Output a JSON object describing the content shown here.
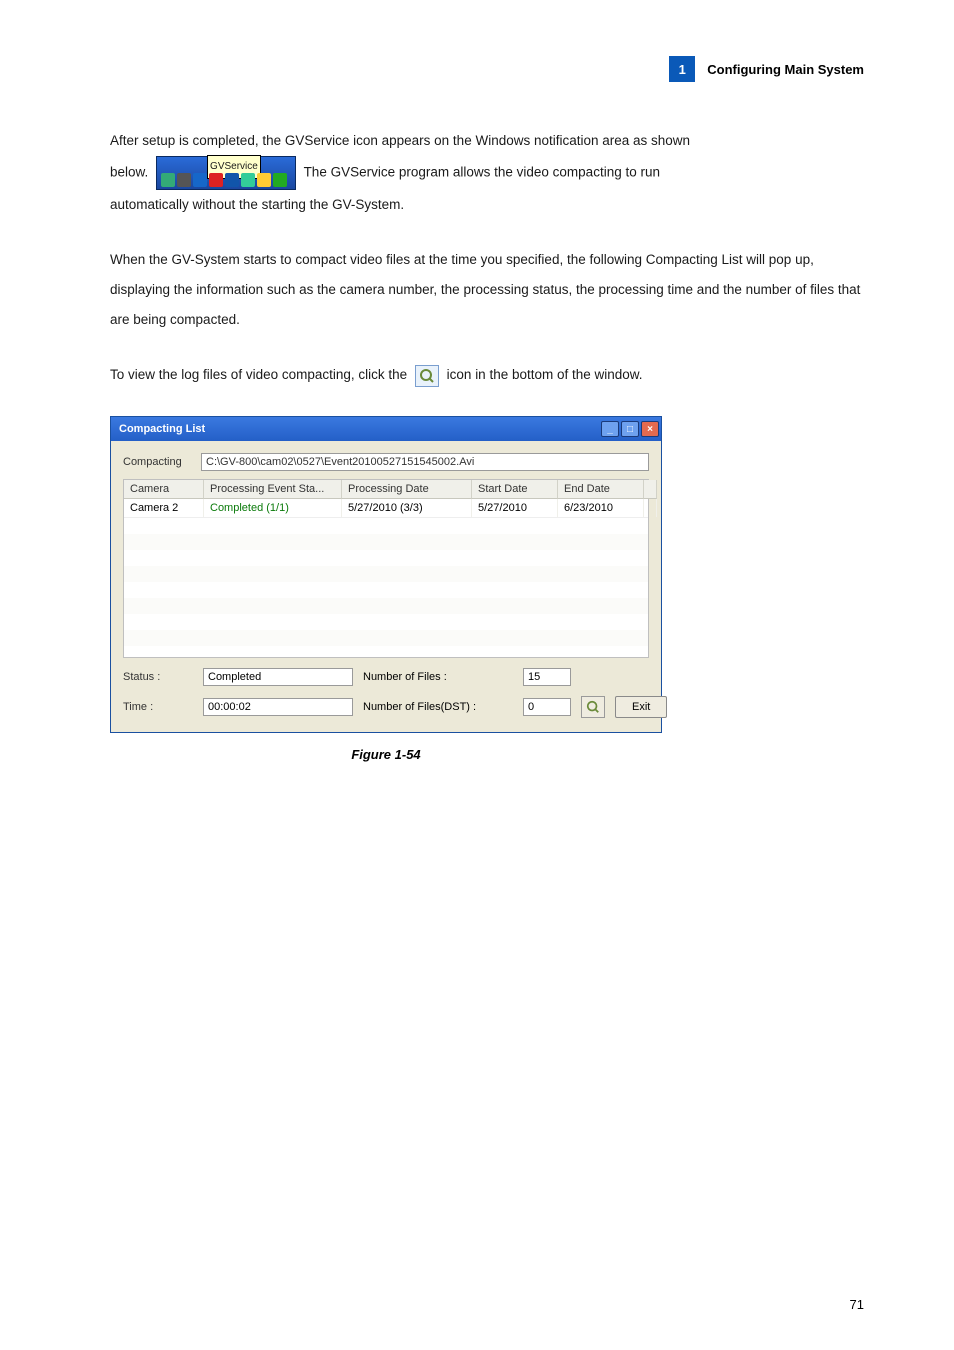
{
  "header": {
    "badge": "1",
    "title": "Configuring Main System"
  },
  "paragraphs": {
    "p1_a": "After setup is completed, the GVService icon appears on the Windows notification area as shown",
    "p1_b": "below.",
    "p1_c": " The GVService program allows the video compacting to run",
    "p1_d": "automatically without the starting the GV-System.",
    "p2": "When the GV-System starts to compact video files at the time you specified, the following Compacting List will pop up, displaying the information such as the camera number, the processing status, the processing time and the number of files that are being compacted.",
    "p3_a": "To view the log files of video compacting, click the ",
    "p3_b": " icon in the bottom of the window."
  },
  "tray_tooltip": "GVService",
  "dialog": {
    "title": "Compacting List",
    "compacting_label": "Compacting",
    "compacting_value": "C:\\GV-800\\cam02\\0527\\Event20100527151545002.Avi",
    "columns": {
      "camera": "Camera",
      "status": "Processing Event Sta...",
      "date": "Processing Date",
      "start": "Start Date",
      "end": "End Date"
    },
    "row": {
      "camera": "Camera 2",
      "status": "Completed (1/1)",
      "date": "5/27/2010 (3/3)",
      "start": "5/27/2010",
      "end": "6/23/2010"
    },
    "status_label": "Status :",
    "status_value": "Completed",
    "nof_label": "Number of Files :",
    "nof_value": "15",
    "time_label": "Time :",
    "time_value": "00:00:02",
    "nof_dst_label": "Number of Files(DST) :",
    "nof_dst_value": "0",
    "exit": "Exit"
  },
  "figure_caption": "Figure 1-54",
  "page_number": "71",
  "icons": {
    "log": "log-file-icon",
    "minimize": "minimize-icon",
    "maximize": "maximize-icon",
    "close": "close-icon"
  },
  "chart_data": {
    "type": "table",
    "title": "Compacting List",
    "columns": [
      "Camera",
      "Processing Event Status",
      "Processing Date",
      "Start Date",
      "End Date"
    ],
    "rows": [
      [
        "Camera 2",
        "Completed (1/1)",
        "5/27/2010 (3/3)",
        "5/27/2010",
        "6/23/2010"
      ]
    ],
    "summary": {
      "Status": "Completed",
      "Number of Files": 15,
      "Time": "00:00:02",
      "Number of Files (DST)": 0
    }
  }
}
